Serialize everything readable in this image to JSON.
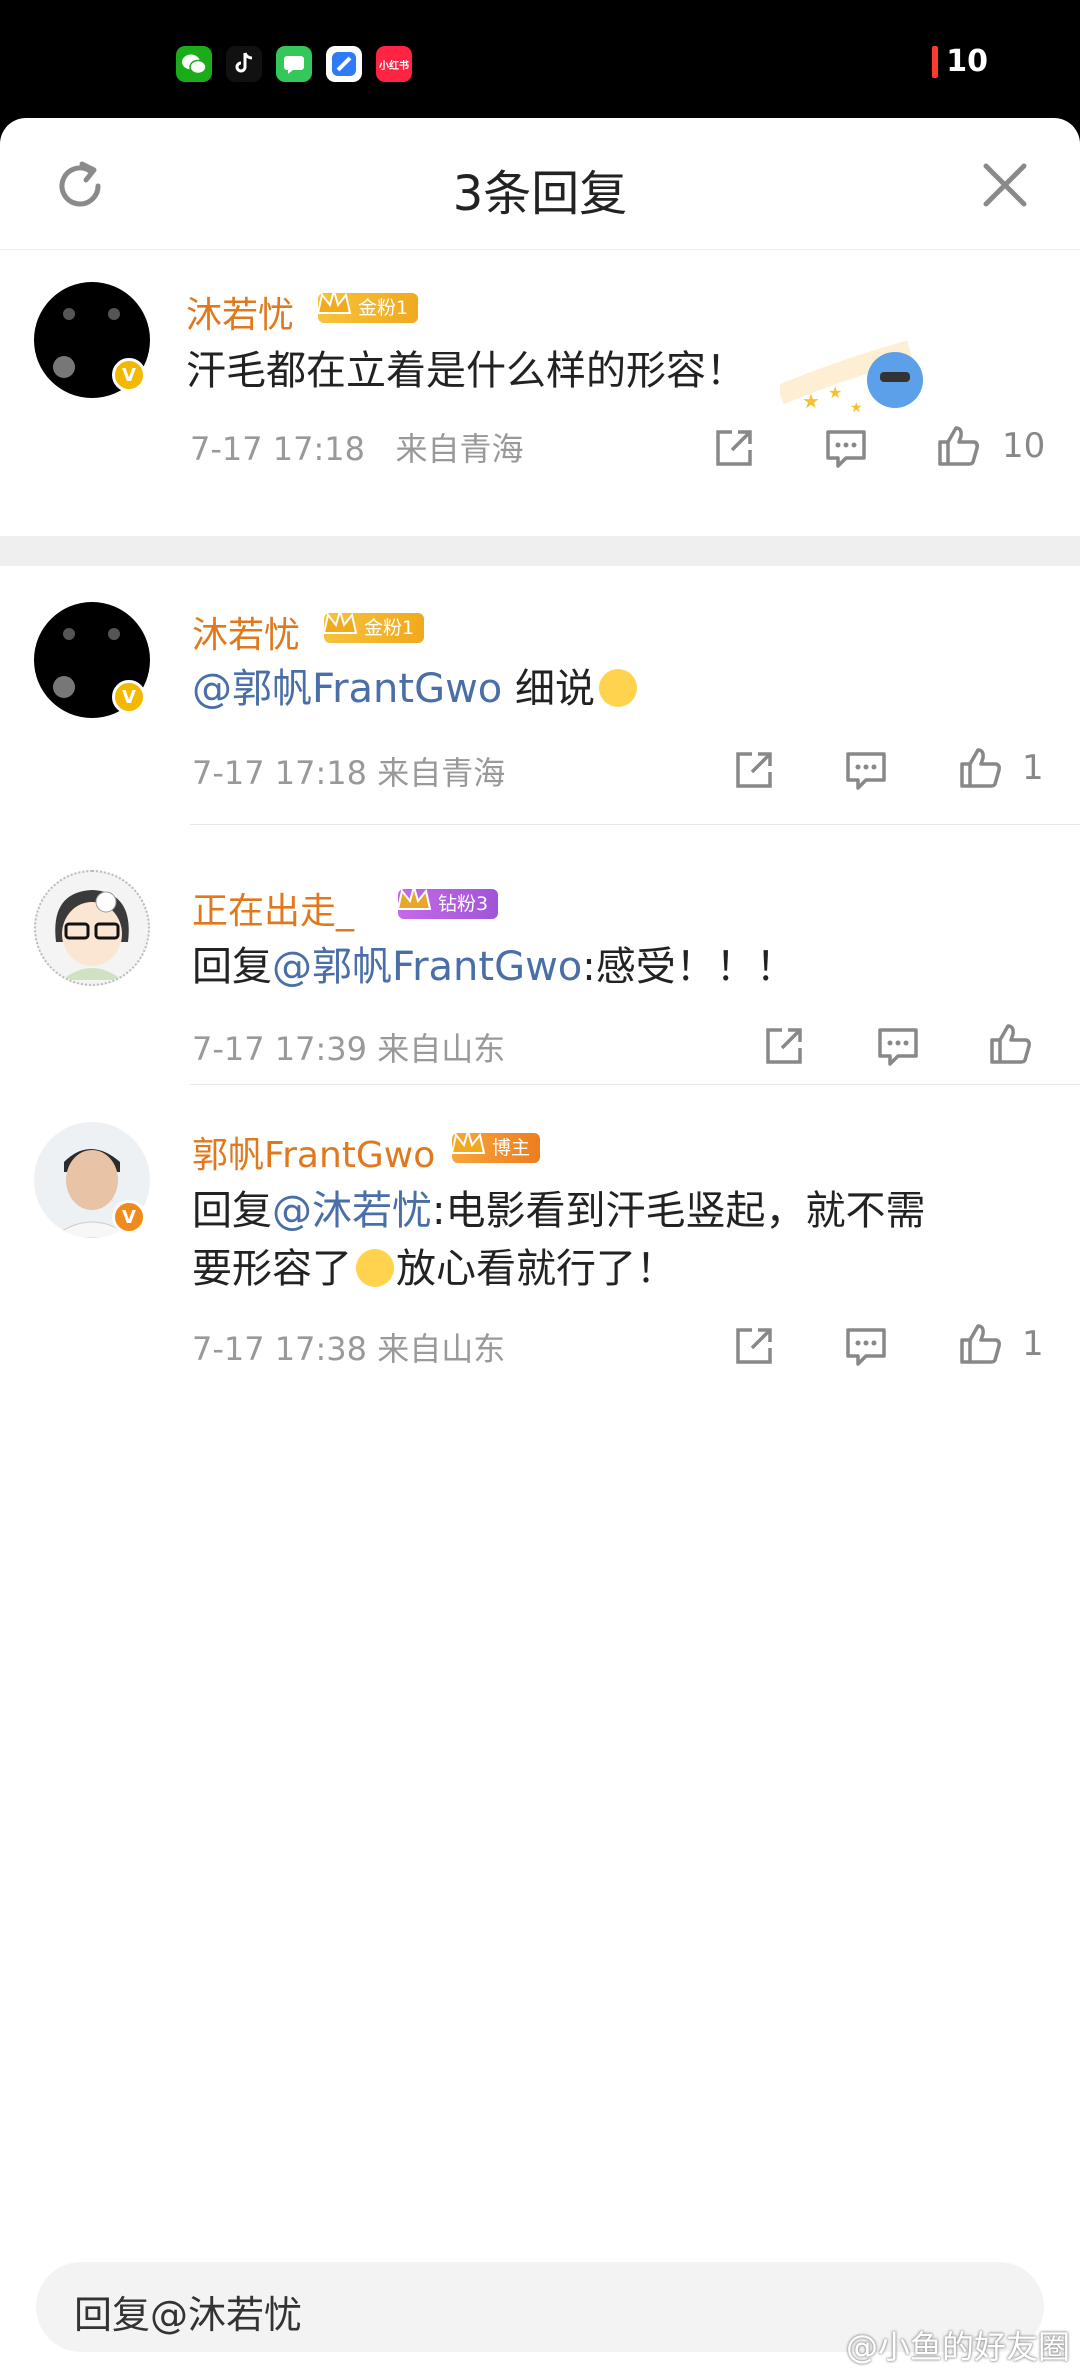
{
  "status_bar": {
    "battery": "10",
    "apps": [
      {
        "icon": "wechat-icon",
        "color": "#1aad19"
      },
      {
        "icon": "tiktok-icon",
        "color": "#111111"
      },
      {
        "icon": "messages-icon",
        "color": "#34c759"
      },
      {
        "icon": "browser-icon",
        "color": "#2f7bf5"
      },
      {
        "icon": "xiaohongshu-icon",
        "color": "#ff2442",
        "label": "小红书"
      }
    ]
  },
  "header": {
    "title": "3条回复"
  },
  "root_comment": {
    "author": "沐若忧",
    "badge": "金粉1",
    "text": "汗毛都在立着是什么样的形容！",
    "time": "7-17 17:18",
    "source": "来自青海",
    "likes": "10"
  },
  "replies": [
    {
      "author": "沐若忧",
      "badge": "金粉1",
      "mention": "@郭帆FrantGwo",
      "text": " 细说",
      "time": "7-17 17:18",
      "source": "来自青海",
      "likes": "1"
    },
    {
      "author": "正在出走_",
      "badge": "钻粉3",
      "prefix": "回复",
      "mention": "@郭帆FrantGwo",
      "text": ":感受！！！",
      "time": "7-17 17:39",
      "source": "来自山东",
      "likes": ""
    },
    {
      "author": "郭帆FrantGwo",
      "badge": "博主",
      "prefix": "回复",
      "mention": "@沐若忧",
      "text": ":电影看到汗毛竖起，就不需",
      "text_line2a": "要形容了",
      "text_line2b": "放心看就行了！",
      "time": "7-17 17:38",
      "source": "来自山东",
      "likes": "1"
    }
  ],
  "reply_input": {
    "placeholder": "回复@沐若忧"
  },
  "watermark": "@小鱼的好友圈",
  "colors": {
    "name": "#e0791d",
    "link": "#4a6ea8",
    "meta": "#999999"
  }
}
